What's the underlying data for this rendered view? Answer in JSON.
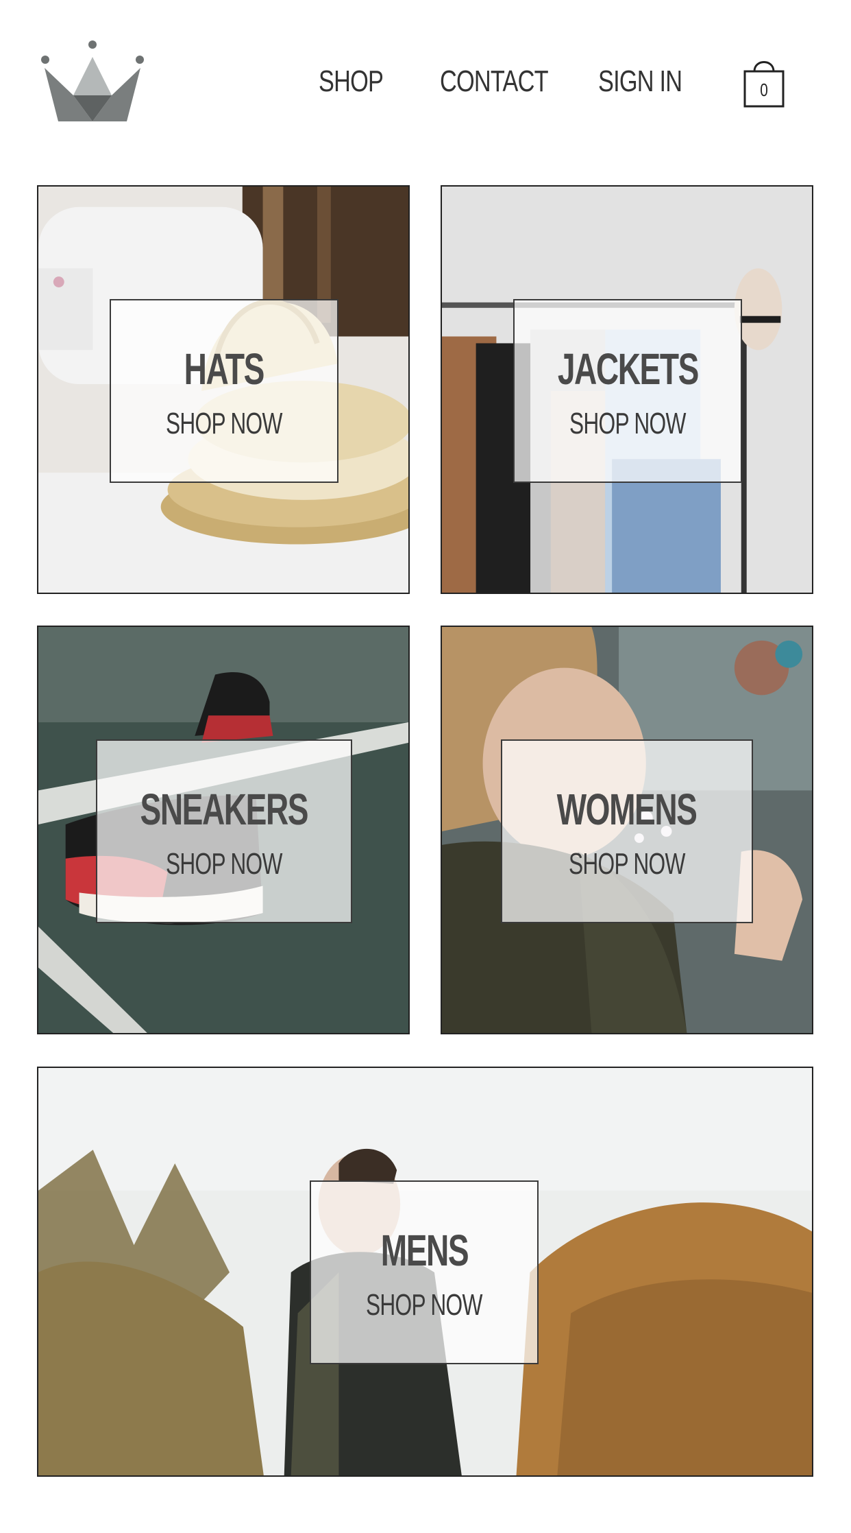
{
  "brand": {
    "logo_icon": "crown-icon",
    "colors": {
      "crown_dark": "#6e7272",
      "crown_light": "#a7abab"
    }
  },
  "nav": {
    "shop": "SHOP",
    "contact": "CONTACT",
    "sign_in": "SIGN IN",
    "cart_icon": "shopping-bag-icon",
    "cart_count": "0"
  },
  "categories": [
    {
      "title": "HATS",
      "cta": "SHOP NOW"
    },
    {
      "title": "JACKETS",
      "cta": "SHOP NOW"
    },
    {
      "title": "SNEAKERS",
      "cta": "SHOP NOW"
    },
    {
      "title": "WOMENS",
      "cta": "SHOP NOW"
    },
    {
      "title": "MENS",
      "cta": "SHOP NOW"
    }
  ]
}
